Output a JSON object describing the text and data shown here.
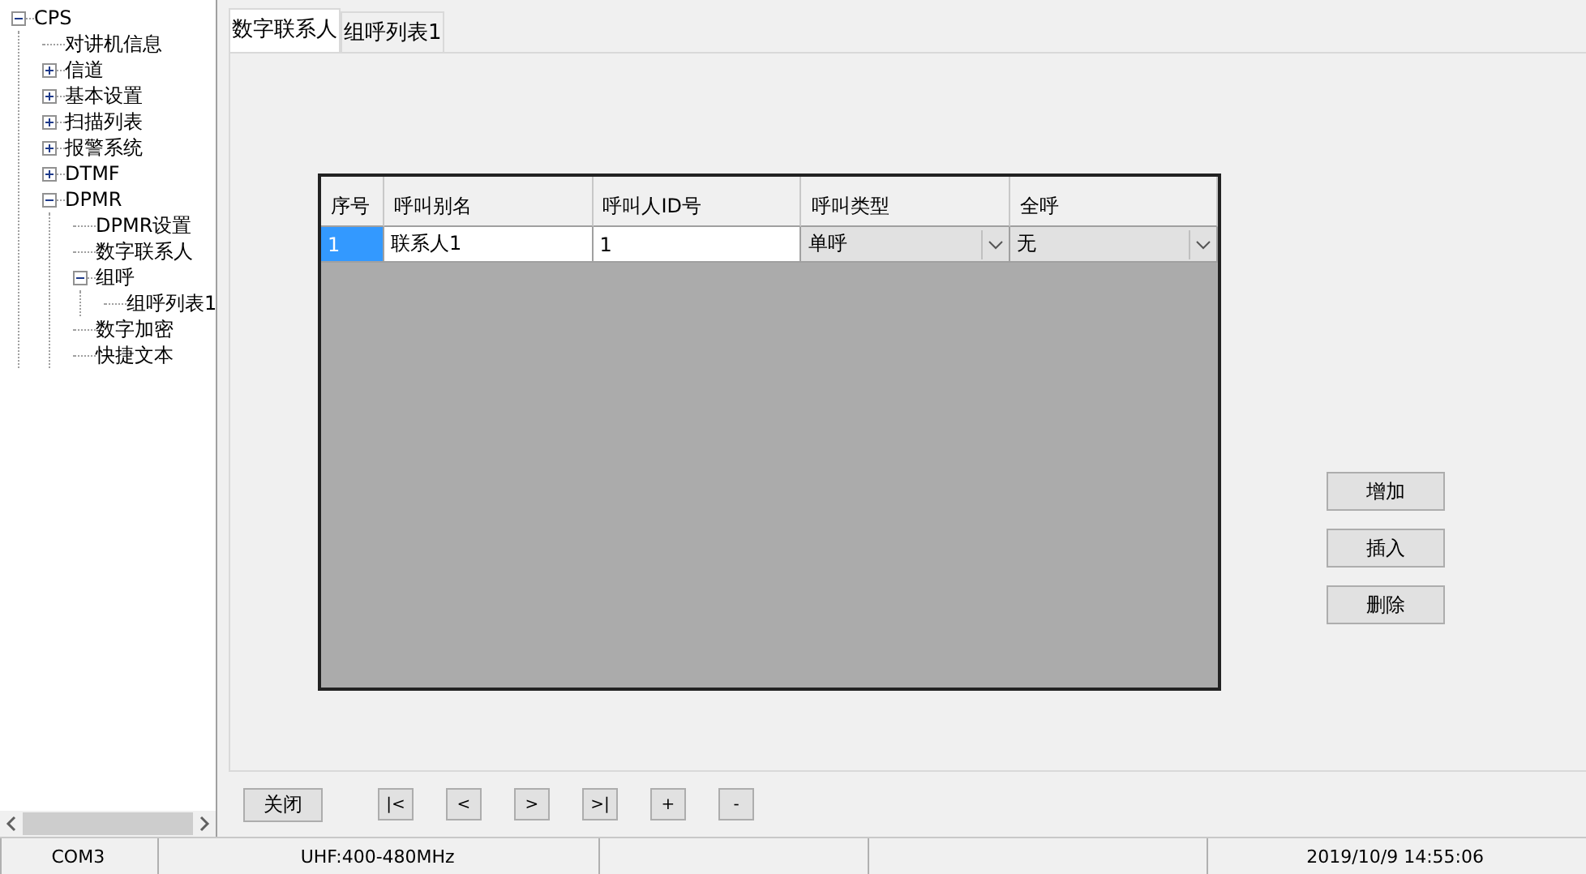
{
  "tree": [
    {
      "label": "CPS",
      "expanded": true,
      "children": [
        {
          "label": "对讲机信息"
        },
        {
          "label": "信道",
          "expanded": false
        },
        {
          "label": "基本设置",
          "expanded": false
        },
        {
          "label": "扫描列表",
          "expanded": false
        },
        {
          "label": "报警系统",
          "expanded": false
        },
        {
          "label": "DTMF",
          "expanded": false
        },
        {
          "label": "DPMR",
          "expanded": true,
          "children": [
            {
              "label": "DPMR设置"
            },
            {
              "label": "数字联系人"
            },
            {
              "label": "组呼",
              "expanded": true,
              "children": [
                {
                  "label": "组呼列表1"
                }
              ]
            },
            {
              "label": "数字加密"
            },
            {
              "label": "快捷文本"
            }
          ]
        }
      ]
    }
  ],
  "tabs": [
    {
      "label": "数字联系人",
      "selected": true
    },
    {
      "label": "组呼列表1",
      "selected": false
    }
  ],
  "table": {
    "columns": [
      "序号",
      "呼叫别名",
      "呼叫人ID号",
      "呼叫类型",
      "全呼"
    ],
    "rows": [
      {
        "cells": [
          {
            "kind": "text",
            "value": "1",
            "selected": true
          },
          {
            "kind": "text",
            "value": "联系人1",
            "selected": false
          },
          {
            "kind": "text",
            "value": "1",
            "selected": false
          },
          {
            "kind": "dropdown",
            "value": "单呼",
            "selected": false
          },
          {
            "kind": "dropdown",
            "value": "无",
            "selected": false
          }
        ]
      }
    ]
  },
  "side_buttons": [
    "增加",
    "插入",
    "删除"
  ],
  "close_button": "关闭",
  "nav_buttons": [
    "|<",
    "<",
    ">",
    ">|",
    "+",
    "-"
  ],
  "status_bar": {
    "port": "COM3",
    "band": "UHF:400-480MHz",
    "clock": "2019/10/9 14:55:06"
  }
}
